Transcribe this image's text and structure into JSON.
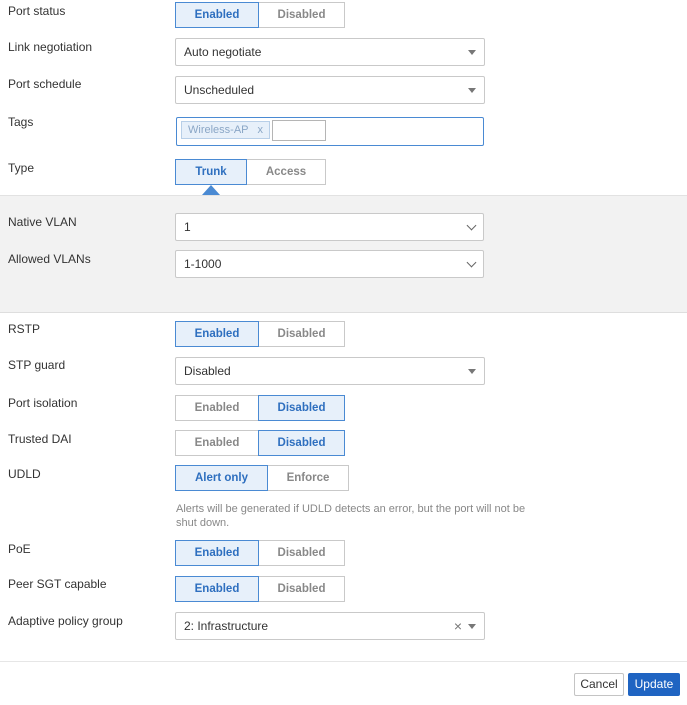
{
  "port_status": {
    "label": "Port status",
    "options": [
      "Enabled",
      "Disabled"
    ],
    "selected": "Enabled"
  },
  "link_negotiation": {
    "label": "Link negotiation",
    "value": "Auto negotiate"
  },
  "port_schedule": {
    "label": "Port schedule",
    "value": "Unscheduled"
  },
  "tags": {
    "label": "Tags",
    "chips": [
      "Wireless-AP"
    ],
    "chip_remove": "x",
    "input_value": ""
  },
  "type": {
    "label": "Type",
    "options": [
      "Trunk",
      "Access"
    ],
    "selected": "Trunk"
  },
  "native_vlan": {
    "label": "Native VLAN",
    "value": "1"
  },
  "allowed_vlans": {
    "label": "Allowed VLANs",
    "value": "1-1000"
  },
  "rstp": {
    "label": "RSTP",
    "options": [
      "Enabled",
      "Disabled"
    ],
    "selected": "Enabled"
  },
  "stp_guard": {
    "label": "STP guard",
    "value": "Disabled"
  },
  "port_isolation": {
    "label": "Port isolation",
    "options": [
      "Enabled",
      "Disabled"
    ],
    "selected": "Disabled"
  },
  "trusted_dai": {
    "label": "Trusted DAI",
    "options": [
      "Enabled",
      "Disabled"
    ],
    "selected": "Disabled"
  },
  "udld": {
    "label": "UDLD",
    "options": [
      "Alert only",
      "Enforce"
    ],
    "selected": "Alert only",
    "hint": "Alerts will be generated if UDLD detects an error, but the port will not be shut down."
  },
  "poe": {
    "label": "PoE",
    "options": [
      "Enabled",
      "Disabled"
    ],
    "selected": "Enabled"
  },
  "peer_sgt": {
    "label": "Peer SGT capable",
    "options": [
      "Enabled",
      "Disabled"
    ],
    "selected": "Enabled"
  },
  "adaptive_policy_group": {
    "label": "Adaptive policy group",
    "value": "2: Infrastructure",
    "clear": "×"
  },
  "footer": {
    "cancel": "Cancel",
    "update": "Update"
  },
  "colors": {
    "accent": "#4a8ad3",
    "active_bg": "#e7f0fa",
    "primary_button": "#1f64c2",
    "section_bg": "#f2f2f2"
  }
}
